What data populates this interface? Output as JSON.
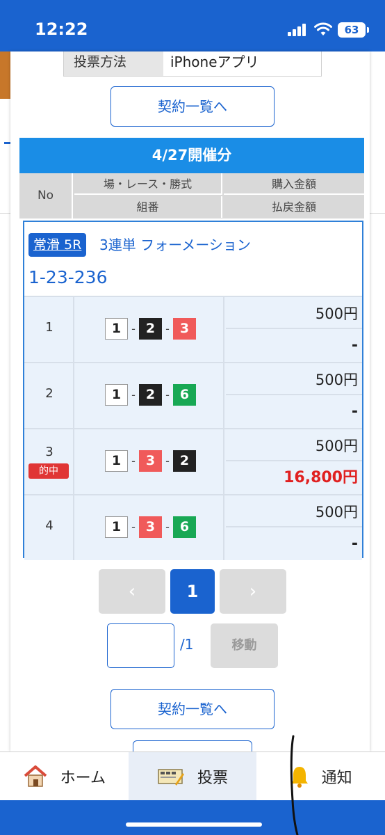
{
  "status_bar": {
    "time": "12:22",
    "battery": "63"
  },
  "top_table": {
    "label": "投票方法",
    "value": "iPhoneアプリ"
  },
  "contract_list_button": "契約一覧へ",
  "date_header": "4/27開催分",
  "columns": {
    "no": "No",
    "venue_race_type": "場・レース・勝式",
    "purchase_amount": "購入金額",
    "combination": "組番",
    "payout_amount": "払戻金額"
  },
  "ticket": {
    "venue_race": "常滑 5R",
    "bet_type": "3連単 フォーメーション",
    "combination": "1-23-236",
    "rows": [
      {
        "no": "1",
        "numbers": [
          "1",
          "2",
          "3"
        ],
        "purchase": "500円",
        "payout": "-",
        "hit": false
      },
      {
        "no": "2",
        "numbers": [
          "1",
          "2",
          "6"
        ],
        "purchase": "500円",
        "payout": "-",
        "hit": false
      },
      {
        "no": "3",
        "numbers": [
          "1",
          "3",
          "2"
        ],
        "purchase": "500円",
        "payout": "16,800円",
        "hit": true,
        "hit_label": "的中"
      },
      {
        "no": "4",
        "numbers": [
          "1",
          "3",
          "6"
        ],
        "purchase": "500円",
        "payout": "-",
        "hit": false
      }
    ],
    "boat_colors": {
      "1": "#ffffff",
      "2": "#222222",
      "3": "#f05a5a",
      "6": "#18a854"
    }
  },
  "pager": {
    "prev": "‹",
    "current": "1",
    "next": "›",
    "total": "/1",
    "move_label": "移動",
    "input_value": ""
  },
  "bottom_nav": [
    {
      "label": "ホーム",
      "icon": "house-icon"
    },
    {
      "label": "投票",
      "icon": "ticket-icon",
      "active": true
    },
    {
      "label": "通知",
      "icon": "bell-icon"
    }
  ]
}
